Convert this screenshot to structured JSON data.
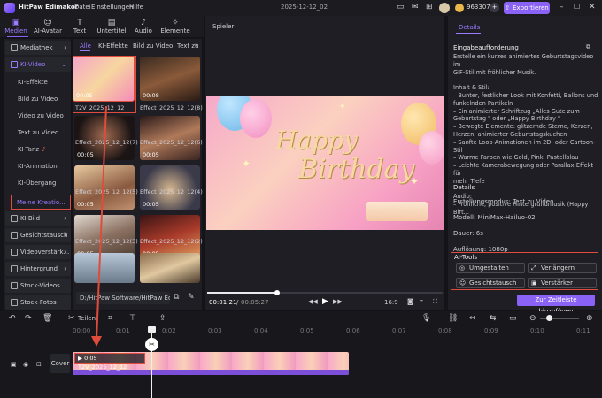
{
  "app": {
    "name": "HitPaw Edimakor",
    "project": "2025-12-12_02",
    "coins": "963307",
    "export_label": "Exportieren"
  },
  "menu": [
    "Datei",
    "Einstellungen",
    "Hilfe"
  ],
  "toolbar": [
    {
      "label": "Medien",
      "icon": "media-icon"
    },
    {
      "label": "AI-Avatar",
      "icon": "avatar-icon"
    },
    {
      "label": "Text",
      "icon": "text-icon"
    },
    {
      "label": "Untertitel",
      "icon": "subtitle-icon"
    },
    {
      "label": "Audio",
      "icon": "audio-icon"
    },
    {
      "label": "Elemente",
      "icon": "elements-icon"
    }
  ],
  "sidebar": {
    "top": [
      "Mediathek",
      "KI-Video"
    ],
    "sub": [
      "KI-Effekte",
      "Bild zu Video",
      "Video zu Video",
      "Text zu Video",
      "KI-Tanz",
      "KI-Animation",
      "KI-Übergang",
      "Meine Kreatio..."
    ],
    "bottom": [
      "KI-Bild",
      "Gesichtstausch",
      "Videoverstärk...",
      "Hintergrund",
      "Stock-Videos",
      "Stock-Fotos"
    ]
  },
  "media": {
    "tabs": [
      "Alle",
      "KI-Effekte",
      "Bild zu Video",
      "Text zu"
    ],
    "items": [
      {
        "name": "T2V_2025_12_12",
        "dur": "00:05"
      },
      {
        "name": "Effect_2025_12_12(8)",
        "dur": "00:08"
      },
      {
        "name": "Effect_2025_12_12(7)",
        "dur": "00:05"
      },
      {
        "name": "Effect_2025_12_12(6)",
        "dur": "00:05"
      },
      {
        "name": "Effect_2025_12_12(5)",
        "dur": "00:05"
      },
      {
        "name": "Effect_2025_12_12(4)",
        "dur": "00:05"
      },
      {
        "name": "Effect_2025_12_12(3)",
        "dur": "00:05"
      },
      {
        "name": "Effect_2025_12_12(2)",
        "dur": "00:05"
      },
      {
        "name": "",
        "dur": ""
      },
      {
        "name": "",
        "dur": ""
      }
    ],
    "path": "D:/HitPaw Software/HitPaw Edi..."
  },
  "preview": {
    "title": "Spieler",
    "overlay_line1": "Happy",
    "overlay_line2": "Birthday",
    "time_current": "00:01:21",
    "time_total": "00:05:27",
    "ratio": "16:9",
    "progress": 0.3
  },
  "details": {
    "tab": "Details",
    "prompt_title": "Eingabeaufforderung",
    "prompt": [
      "Erstelle ein kurzes animiertes Geburtstagsvideo im",
      "GIF-Stil mit fröhlicher Musik.",
      "",
      "Inhalt & Stil:",
      "– Bunter, festlicher Look mit Konfetti, Ballons und",
      "funkelnden Partikeln",
      "– Ein animierter Schriftzug „Alles Gute zum",
      "Geburtstag \" oder „Happy Birthday \"",
      "– Bewegte Elemente: glitzernde Sterne, Kerzen,",
      "Herzen, animierter Geburtstagskuchen",
      "– Sanfte Loop-Animationen im 2D- oder Cartoon-Stil",
      "– Warme Farben wie Gold, Pink, Pastellblau",
      "– Leichte Kamerabewegung oder Parallax-Effekt für",
      "mehr Tiefe",
      "",
      "Audio:",
      "– Fröhliche, positive Hintergrundmusik (Happy Birt..."
    ],
    "details_title": "Details",
    "mode": "Erstellungsmodus: Text zu Video",
    "model": "Modell: MiniMax-Hailuo-02",
    "duration": "Dauer: 6s",
    "resolution": "Auflösung: 1080p",
    "ai_tools_title": "AI-Tools",
    "tools": [
      "Umgestalten",
      "Verlängern",
      "Gesichtstausch",
      "Verstärker"
    ],
    "add_button": "Zur Zeitleiste hinzufügen"
  },
  "timeline": {
    "split_label": "Teilen",
    "ticks": [
      "00:00",
      "0:01",
      "0:02",
      "0:03",
      "0:04",
      "0:05",
      "0:06",
      "0:07",
      "0:08",
      "0:09",
      "0:10",
      "0:11"
    ],
    "cover": "Cover",
    "clip": "0:05  T2V_2025_12_12"
  },
  "colors": {
    "accent": "#8a63f6",
    "highlight": "#e04c3c",
    "bg": "#141418",
    "panel": "#1e1e24"
  }
}
